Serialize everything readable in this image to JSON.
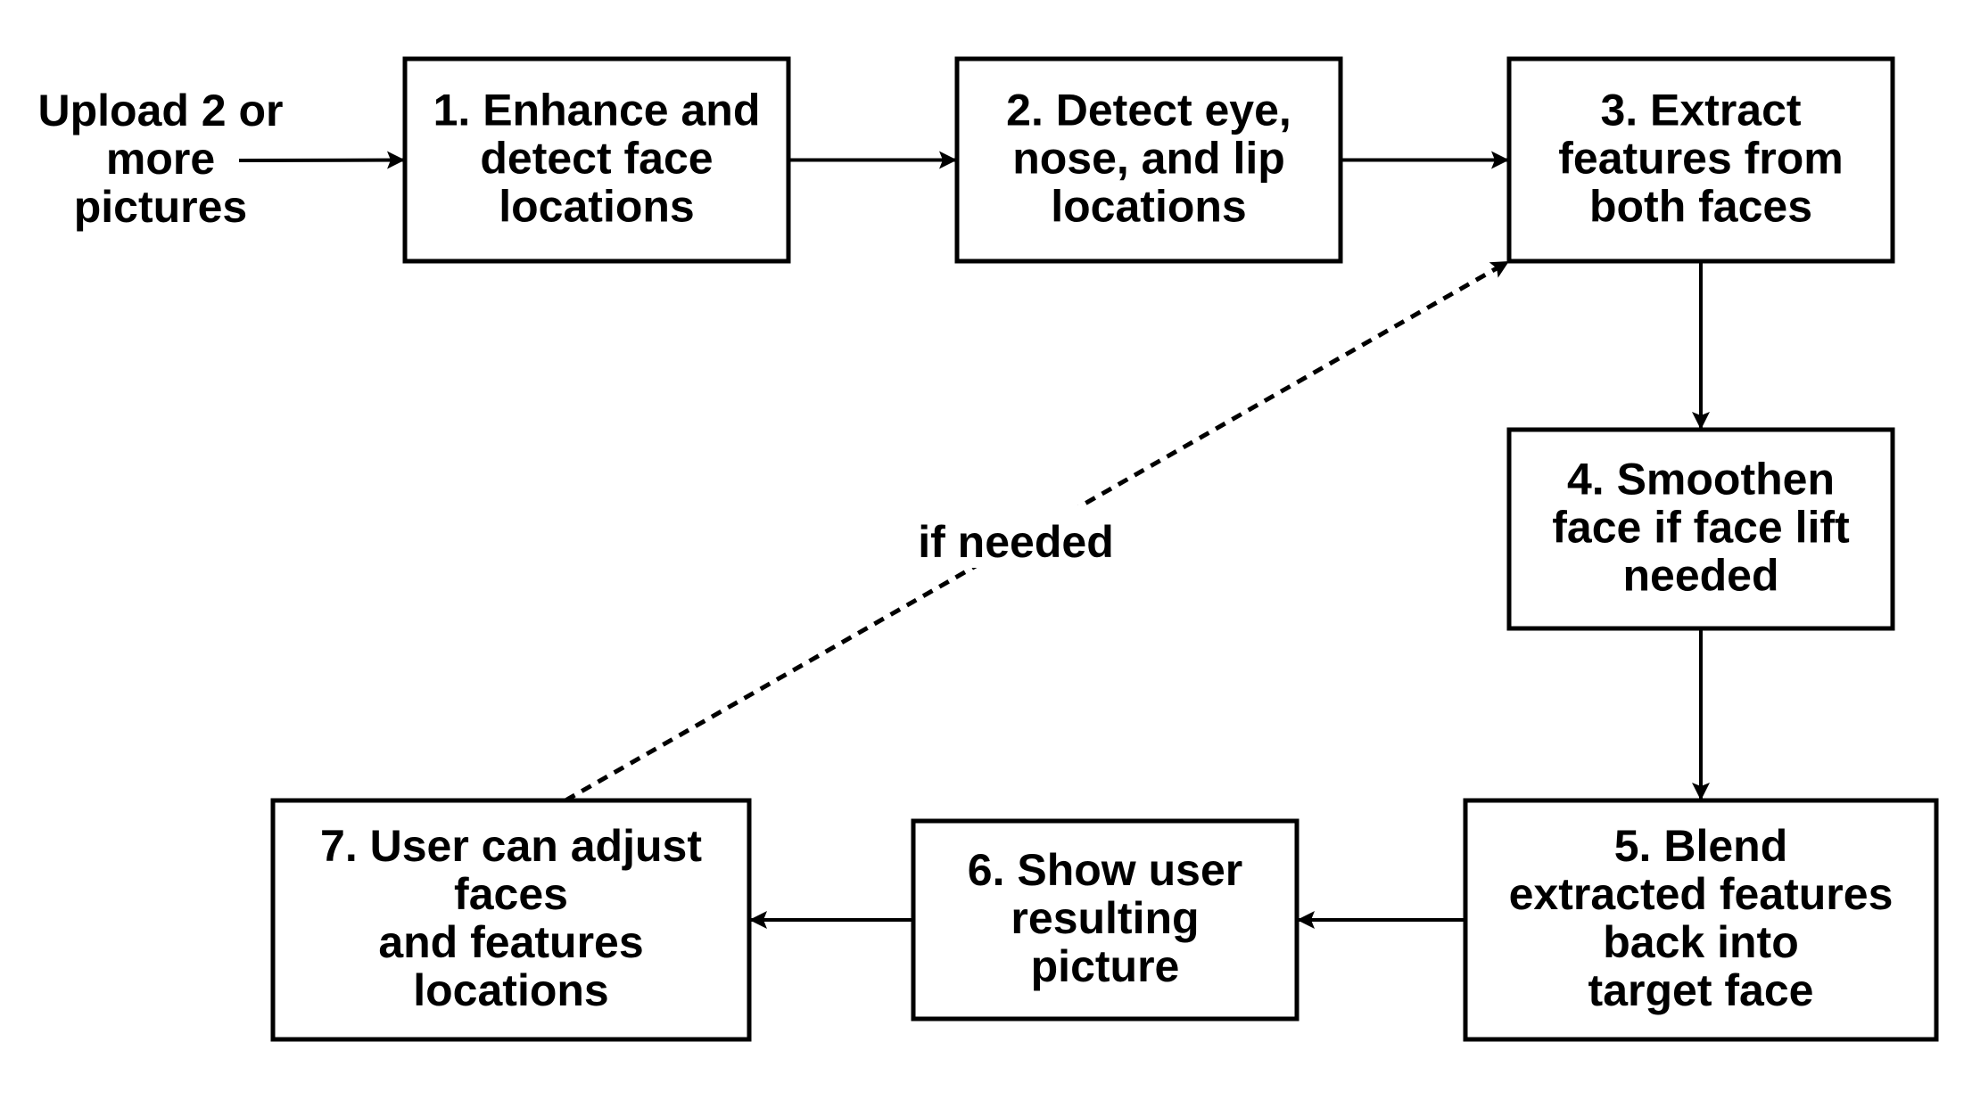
{
  "diagram": {
    "type": "flowchart",
    "colors": {
      "stroke": "#000000",
      "background": "#ffffff",
      "text": "#000000"
    },
    "input": {
      "id": "input",
      "lines": [
        "Upload 2 or",
        "more",
        "pictures"
      ]
    },
    "nodes": [
      {
        "id": "n1",
        "lines": [
          "1. Enhance and",
          "detect face",
          "locations"
        ]
      },
      {
        "id": "n2",
        "lines": [
          "2. Detect eye,",
          "nose, and lip",
          "locations"
        ]
      },
      {
        "id": "n3",
        "lines": [
          "3. Extract",
          "features from",
          "both faces"
        ]
      },
      {
        "id": "n4",
        "lines": [
          "4. Smoothen",
          "face if face lift",
          "needed"
        ]
      },
      {
        "id": "n5",
        "lines": [
          "5. Blend",
          "extracted features",
          "back into",
          "target face"
        ]
      },
      {
        "id": "n6",
        "lines": [
          "6. Show user",
          "resulting",
          "picture"
        ]
      },
      {
        "id": "n7",
        "lines": [
          "7. User can adjust",
          "faces",
          "and features",
          "locations"
        ]
      }
    ],
    "edges": [
      {
        "from": "input",
        "to": "n1",
        "style": "solid"
      },
      {
        "from": "n1",
        "to": "n2",
        "style": "solid"
      },
      {
        "from": "n2",
        "to": "n3",
        "style": "solid"
      },
      {
        "from": "n3",
        "to": "n4",
        "style": "solid"
      },
      {
        "from": "n4",
        "to": "n5",
        "style": "solid"
      },
      {
        "from": "n5",
        "to": "n6",
        "style": "solid"
      },
      {
        "from": "n6",
        "to": "n7",
        "style": "solid"
      },
      {
        "from": "n7",
        "to": "n3",
        "style": "dashed",
        "label": "if needed"
      }
    ]
  }
}
